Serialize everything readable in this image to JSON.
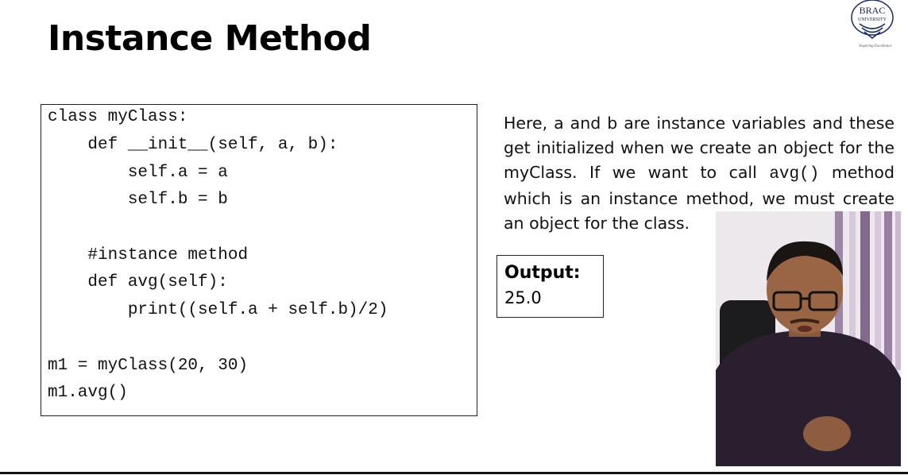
{
  "slide": {
    "title": "Instance Method"
  },
  "logo": {
    "name": "BRAC",
    "subname": "UNIVERSITY",
    "tagline": "Inspiring Excellence",
    "color": "#1a2a6c"
  },
  "code": {
    "lines": [
      "class myClass:",
      "    def __init__(self, a, b):",
      "        self.a = a",
      "        self.b = b",
      "",
      "    #instance method",
      "    def avg(self):",
      "        print((self.a + self.b)/2)",
      "",
      "m1 = myClass(20, 30)",
      "m1.avg()"
    ]
  },
  "description": {
    "part1": "Here, a and b are instance variables and these get initialized when we create an object for the myClass. If we want to call ",
    "code": "avg()",
    "part2": " method which is an instance method, we must create an object for the class."
  },
  "output": {
    "label": "Output:",
    "value": "25.0"
  },
  "presenter": {
    "icon": "presenter-webcam-video"
  }
}
